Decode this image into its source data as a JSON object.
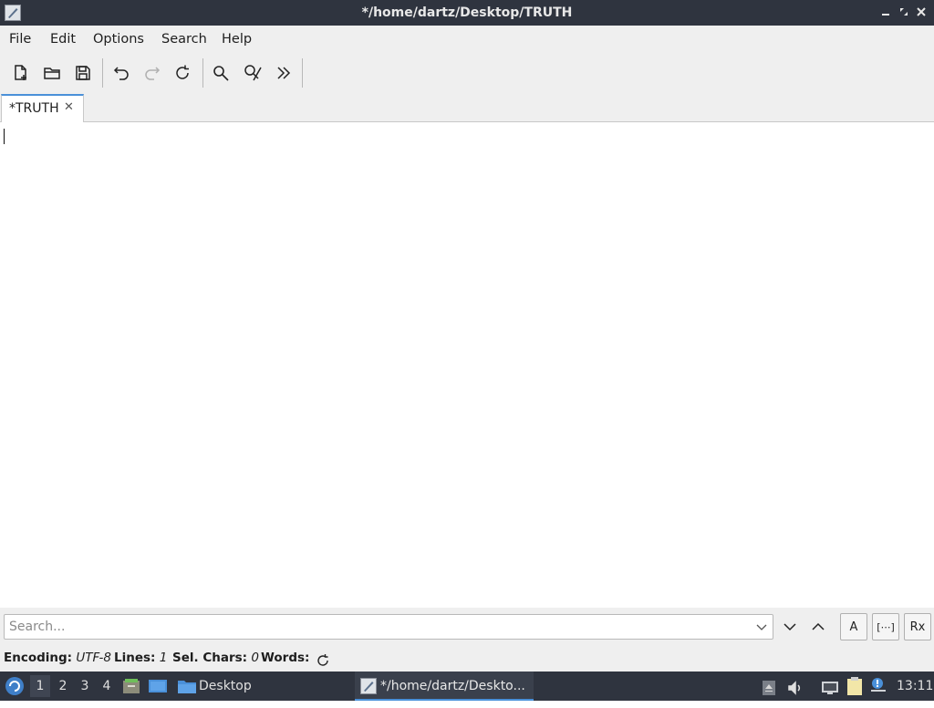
{
  "window": {
    "title": "*/home/dartz/Desktop/TRUTH",
    "controls": [
      "minimize",
      "maximize",
      "close"
    ]
  },
  "menubar": {
    "items": [
      "File",
      "Edit",
      "Options",
      "Search",
      "Help"
    ]
  },
  "toolbar": {
    "buttons": [
      "new-file",
      "open-file",
      "save-file",
      "undo",
      "redo",
      "reload",
      "find",
      "replace",
      "go-to-line"
    ]
  },
  "tabs": [
    {
      "label": "*TRUTH",
      "close": "✕",
      "active": true
    }
  ],
  "editor": {
    "content": ""
  },
  "searchbar": {
    "placeholder": "Search...",
    "buttons": {
      "case_sensitive": "A",
      "whole_word": "[⋯]",
      "regex": "Rx"
    }
  },
  "statusbar": {
    "encoding_label": "Encoding:",
    "encoding_value": "UTF-8",
    "lines_label": "Lines:",
    "lines_value": "1",
    "sel_label": "Sel. Chars:",
    "sel_value": "0",
    "words_label": "Words:"
  },
  "taskbar": {
    "desktops": [
      "1",
      "2",
      "3",
      "4"
    ],
    "active_desktop": "1",
    "desktop_folder": "Desktop",
    "window_task": "*/home/dartz/Deskto...",
    "clock": "13:11"
  },
  "colors": {
    "titlebar_bg": "#2f343f",
    "chrome_bg": "#efefef",
    "accent": "#4a90d9"
  }
}
